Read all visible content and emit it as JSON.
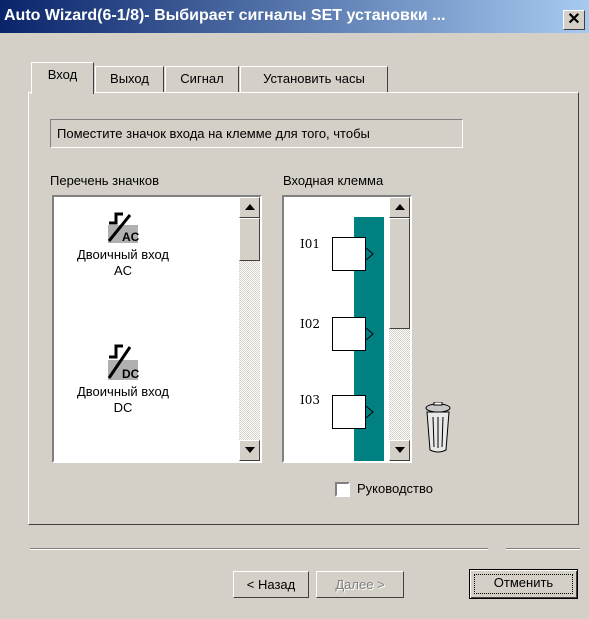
{
  "window": {
    "title": "Auto Wizard(6-1/8)- Выбирает сигналы SET установки ...",
    "close_label": "✕"
  },
  "tabs": [
    {
      "label": "Вход",
      "active": true
    },
    {
      "label": "Выход"
    },
    {
      "label": "Сигнал"
    },
    {
      "label": "Установить часы"
    }
  ],
  "info": "Поместите значок входа на клемме для того, чтобы",
  "icon_list": {
    "header": "Перечень значков",
    "items": [
      {
        "glyph": "AC",
        "line1": "Двоичный вход",
        "line2": "AC"
      },
      {
        "glyph": "DC",
        "line1": "Двоичный вход",
        "line2": "DC"
      }
    ]
  },
  "terminal_list": {
    "header": "Входная клемма",
    "terminals": [
      "I01",
      "I02",
      "I03"
    ],
    "bus_color": "#008080"
  },
  "manual_checkbox": {
    "label": "Руководство",
    "checked": false
  },
  "buttons": {
    "back": "< Назад",
    "next": "Далее >",
    "cancel": "Отменить"
  },
  "icons": {
    "trash": "trash-icon",
    "up": "arrow-up-icon",
    "down": "arrow-down-icon"
  }
}
